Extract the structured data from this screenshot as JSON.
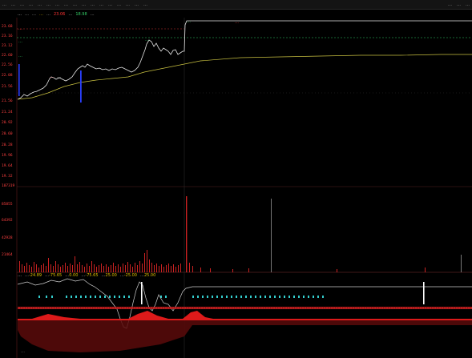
{
  "toolbar": {
    "left_items": [
      "…",
      "…",
      "…",
      "…",
      "…",
      "…",
      "…",
      "…",
      "…",
      "…",
      "…",
      "…",
      "…",
      "…",
      "…",
      "…",
      "…"
    ],
    "right_items": [
      "…",
      "…",
      "…"
    ]
  },
  "header": {
    "stock_name": "…",
    "chart_tag": "…",
    "indicator_name": "…",
    "vol_label": "…",
    "price_label": "…",
    "price_value": "23.06",
    "chg_label": "…",
    "chg_value": "18.98",
    "extra_label": "…"
  },
  "price_axis": [
    "23.68",
    "23.16",
    "23.12",
    "22.60",
    "22.56",
    "22.08",
    "21.56",
    "21.56",
    "21.24",
    "20.92",
    "20.60",
    "20.28",
    "19.96",
    "19.64",
    "19.32",
    "19.00"
  ],
  "volume_axis": [
    "107319",
    "85855",
    "64392",
    "42928",
    "21464"
  ],
  "annotations": {
    "high_pct": "…",
    "mid_pct": "…",
    "low_pct": "…",
    "buy_marker": "…",
    "hold_marker": "…",
    "note_marker": "…",
    "sell_marker": "…",
    "right_note": "…"
  },
  "indicator_panel": {
    "name": "…",
    "pairs": [
      {
        "label": "…",
        "value": "-24.89"
      },
      {
        "label": "…",
        "value": "-75.65"
      },
      {
        "label": "…",
        "value": "0.00"
      },
      {
        "label": "…",
        "value": "-75.65"
      },
      {
        "label": "…",
        "value": "25.00"
      },
      {
        "label": "…",
        "value": "-25.00"
      },
      {
        "label": "…",
        "value": "25.00"
      }
    ]
  },
  "bottom_label": "…",
  "colors": {
    "background": "#000000",
    "price_line": "#e6e6e6",
    "avg_line": "#c8c040",
    "up": "#ff3333",
    "down": "#33cc66",
    "cyan": "#33cccc",
    "axis_text": "#ff4040"
  }
}
